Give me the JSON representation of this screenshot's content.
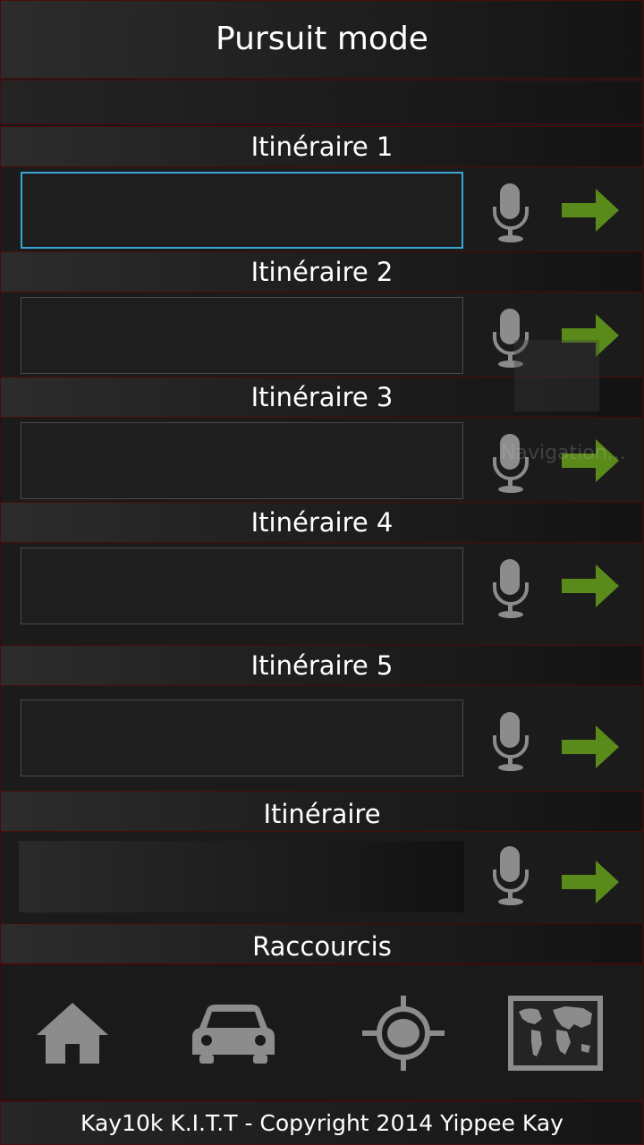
{
  "header": {
    "title": "Pursuit mode"
  },
  "routes": [
    {
      "label": "Itinéraire 1",
      "value": "",
      "focused": true
    },
    {
      "label": "Itinéraire 2",
      "value": ""
    },
    {
      "label": "Itinéraire 3",
      "value": ""
    },
    {
      "label": "Itinéraire 4",
      "value": ""
    },
    {
      "label": "Itinéraire 5",
      "value": ""
    }
  ],
  "extra_route": {
    "label": "Itinéraire",
    "value": ""
  },
  "overlay": {
    "text": "Navigation..."
  },
  "shortcuts": {
    "label": "Raccourcis",
    "items": [
      {
        "icon": "home-icon"
      },
      {
        "icon": "car-icon"
      },
      {
        "icon": "gps-target-icon"
      },
      {
        "icon": "world-map-icon"
      }
    ]
  },
  "icons": {
    "mic": "microphone-icon",
    "go": "arrow-right-icon"
  },
  "colors": {
    "accent_focus": "#3aa6d6",
    "arrow_green": "#5a8a1a",
    "border_red": "#4a0b0b"
  },
  "footer": {
    "text": "Kay10k  K.I.T.T - Copyright 2014 Yippee Kay"
  }
}
